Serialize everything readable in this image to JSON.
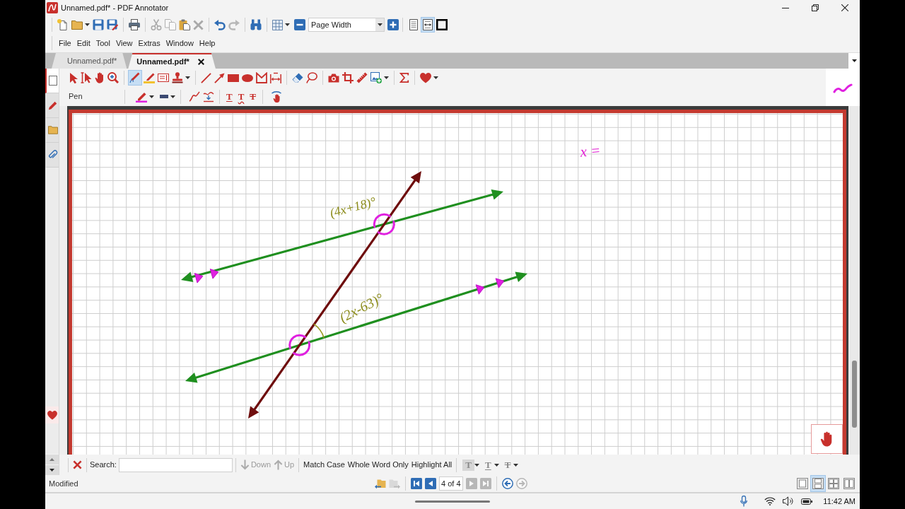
{
  "window": {
    "title": "Unnamed.pdf* - PDF Annotator"
  },
  "toolbar": {
    "buttons": [
      {
        "disabled": false
      },
      {
        "disabled": false
      },
      {
        "disabled": false
      },
      {
        "disabled": false
      },
      {
        "disabled": false
      },
      {
        "disabled": true
      },
      {
        "disabled": true
      },
      {
        "disabled": false
      },
      {
        "disabled": true
      },
      {
        "disabled": false
      },
      {
        "disabled": true
      },
      {
        "disabled": false
      },
      {
        "disabled": false
      }
    ],
    "zoom": {
      "value": "Page Width"
    },
    "view_buttons": [
      {
        "selected": false
      },
      {
        "selected": true
      },
      {
        "selected": false
      }
    ]
  },
  "menu": [
    {
      "label": "File"
    },
    {
      "label": "Edit"
    },
    {
      "label": "Tool"
    },
    {
      "label": "View"
    },
    {
      "label": "Extras"
    },
    {
      "label": "Window"
    },
    {
      "label": "Help"
    }
  ],
  "tabs": [
    {
      "label": "Unnamed.pdf*",
      "selected": false
    },
    {
      "label": "Unnamed.pdf*",
      "selected": true
    }
  ],
  "side_tabs": [
    {
      "selected": true
    },
    {
      "selected": false
    },
    {
      "selected": false
    },
    {
      "selected": false
    }
  ],
  "annotation_toolbar": {
    "tools": [
      {
        "selected": false
      },
      {
        "selected": false
      },
      {
        "selected": false
      },
      {
        "selected": false
      },
      {
        "selected": true
      },
      {
        "selected": false
      },
      {
        "selected": false
      },
      {
        "selected": false
      },
      {
        "selected": false
      },
      {
        "selected": false
      },
      {
        "selected": false
      },
      {
        "selected": false
      },
      {
        "selected": false
      },
      {
        "selected": false
      },
      {
        "selected": false
      },
      {
        "selected": false
      },
      {
        "selected": false
      },
      {
        "selected": false
      },
      {
        "selected": false
      },
      {
        "selected": false
      },
      {
        "selected": false
      },
      {
        "selected": false
      }
    ],
    "tool_name": "Pen",
    "markup_buttons": [
      {
        "label": "T",
        "kind": "underline"
      },
      {
        "label": "T",
        "kind": "squiggly"
      },
      {
        "label": "T",
        "kind": "strikeout"
      }
    ]
  },
  "page": {
    "annotations": [
      {
        "text": "(4x+18)°",
        "color": "#8c8c1c"
      },
      {
        "text": "(2x-63)°",
        "color": "#8c8c1c"
      },
      {
        "text": "x =",
        "color": "#e01ed2"
      }
    ]
  },
  "search_bar": {
    "label": "Search:",
    "buttons": [
      {
        "label": "Down",
        "disabled": true
      },
      {
        "label": "Up",
        "disabled": true
      }
    ],
    "options": [
      {
        "label": "Match Case"
      },
      {
        "label": "Whole Word Only"
      },
      {
        "label": "Highlight All"
      }
    ],
    "markup_buttons": [
      {
        "label": "T",
        "kind": "highlight"
      },
      {
        "label": "T",
        "kind": "underline"
      },
      {
        "label": "T",
        "kind": "strikeout"
      }
    ]
  },
  "status_bar": {
    "text": "Modified",
    "history_buttons": [
      {
        "disabled": false
      },
      {
        "disabled": true
      }
    ],
    "nav_buttons": [
      {
        "disabled": false
      },
      {
        "disabled": false
      },
      {
        "disabled": true
      },
      {
        "disabled": true
      }
    ],
    "page_field": {
      "value": "4 of 4"
    },
    "back_buttons": [
      {
        "disabled": false
      },
      {
        "disabled": true
      }
    ],
    "layout_buttons": [
      {
        "selected": false
      },
      {
        "selected": true
      },
      {
        "selected": false
      },
      {
        "selected": false
      }
    ]
  },
  "taskbar": {
    "time": "11:42 AM"
  }
}
